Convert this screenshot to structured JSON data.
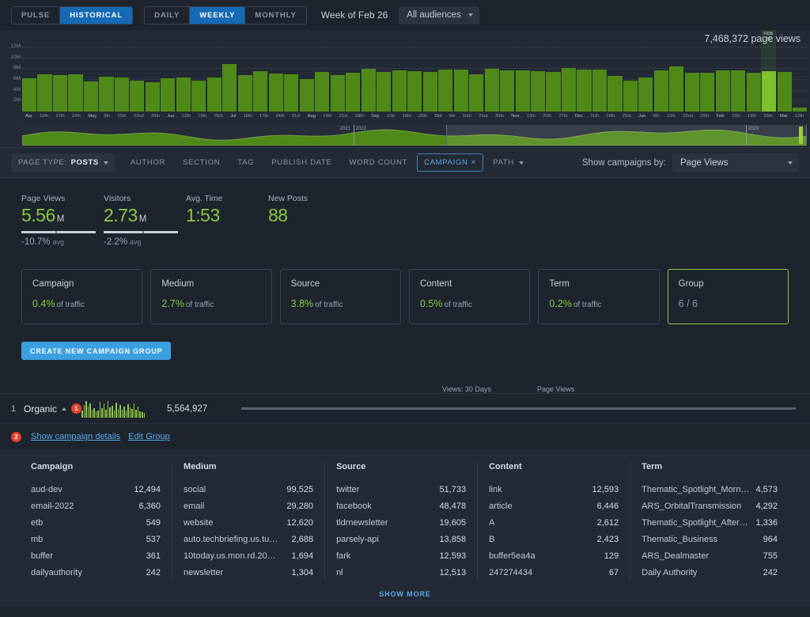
{
  "topbar": {
    "mode_tabs": [
      {
        "label": "PULSE",
        "active": false
      },
      {
        "label": "HISTORICAL",
        "active": true
      }
    ],
    "period_tabs": [
      {
        "label": "DAILY",
        "active": false
      },
      {
        "label": "WEEKLY",
        "active": true
      },
      {
        "label": "MONTHLY",
        "active": false
      }
    ],
    "week_label": "Week of Feb 26",
    "audience": "All audiences"
  },
  "chart_data": {
    "type": "bar",
    "title": "",
    "annotation": "7,468,372 page views",
    "highlight_label_line1": "FEB",
    "highlight_label_line2": "26",
    "highlight_index": 48,
    "ylabel": "",
    "xlabel": "",
    "ylim": [
      0,
      12000000
    ],
    "ytick_labels": [
      "12M",
      "10M",
      "8M",
      "6M",
      "4M",
      "2M"
    ],
    "ytick_values": [
      12000000,
      10000000,
      8000000,
      6000000,
      4000000,
      2000000
    ],
    "categories": [
      "Apr",
      "10th",
      "17th",
      "24th",
      "May",
      "8th",
      "15th",
      "22nd",
      "29th",
      "Jun",
      "12th",
      "19th",
      "26th",
      "Jul",
      "10th",
      "17th",
      "24th",
      "31st",
      "Aug",
      "14th",
      "21st",
      "28th",
      "Sep",
      "11th",
      "18th",
      "25th",
      "Oct",
      "9th",
      "16th",
      "23rd",
      "30th",
      "Nov",
      "13th",
      "20th",
      "27th",
      "Dec",
      "11th",
      "18th",
      "25th",
      "Jan",
      "8th",
      "15th",
      "22nd",
      "29th",
      "Feb",
      "12th",
      "19th",
      "26th",
      "Mar",
      "12th"
    ],
    "month_ticks": [
      "Apr",
      "May",
      "Jun",
      "Jul",
      "Aug",
      "Sep",
      "Oct",
      "Nov",
      "Dec",
      "Jan",
      "Feb",
      "Mar"
    ],
    "values": [
      6100000,
      6950000,
      6700000,
      6900000,
      5500000,
      6450000,
      6350000,
      5750000,
      5400000,
      6200000,
      6350000,
      5750000,
      6250000,
      8750000,
      6800000,
      7450000,
      7000000,
      6950000,
      5950000,
      7350000,
      6750000,
      7150000,
      7900000,
      7350000,
      7550000,
      7500000,
      7300000,
      7700000,
      7700000,
      6900000,
      7900000,
      7600000,
      7600000,
      7500000,
      7300000,
      8000000,
      7700000,
      7750000,
      6600000,
      5650000,
      6250000,
      7600000,
      8400000,
      7150000,
      7150000,
      7600000,
      7650000,
      7150000,
      7468372,
      7250000,
      700000
    ],
    "grid": true,
    "navigator": {
      "year_markers": [
        "2021",
        "2022",
        "2023"
      ],
      "selection_start_pct": 54,
      "selection_end_pct": 100
    }
  },
  "filterbar": {
    "page_type_prefix": "PAGE TYPE:",
    "page_type_value": "POSTS",
    "chips": [
      {
        "label": "AUTHOR",
        "selected": false
      },
      {
        "label": "SECTION",
        "selected": false
      },
      {
        "label": "TAG",
        "selected": false
      },
      {
        "label": "PUBLISH DATE",
        "selected": false
      },
      {
        "label": "WORD COUNT",
        "selected": false
      },
      {
        "label": "CAMPAIGN",
        "selected": true
      },
      {
        "label": "PATH",
        "selected": false
      }
    ],
    "show_by_label": "Show campaigns by:",
    "show_by_value": "Page Views"
  },
  "kpis": [
    {
      "label": "Page Views",
      "value": "5.56",
      "unit": "M",
      "delta": "-10.7%",
      "delta_sub": "avg",
      "has_bar": true,
      "marker_pct": 46
    },
    {
      "label": "Visitors",
      "value": "2.73",
      "unit": "M",
      "delta": "-2.2%",
      "delta_sub": "avg",
      "has_bar": true,
      "marker_pct": 52
    },
    {
      "label": "Avg. Time",
      "value": "1:53",
      "unit": "",
      "delta": "",
      "delta_sub": "",
      "has_bar": false,
      "marker_pct": 0
    },
    {
      "label": "New Posts",
      "value": "88",
      "unit": "",
      "delta": "",
      "delta_sub": "",
      "has_bar": false,
      "marker_pct": 0
    }
  ],
  "dimension_cards": [
    {
      "name": "Campaign",
      "value": "0.4%",
      "sub": "of traffic",
      "active": false,
      "muted": false
    },
    {
      "name": "Medium",
      "value": "2.7%",
      "sub": "of traffic",
      "active": false,
      "muted": false
    },
    {
      "name": "Source",
      "value": "3.8%",
      "sub": "of traffic",
      "active": false,
      "muted": false
    },
    {
      "name": "Content",
      "value": "0.5%",
      "sub": "of traffic",
      "active": false,
      "muted": false
    },
    {
      "name": "Term",
      "value": "0.2%",
      "sub": "of traffic",
      "active": false,
      "muted": false
    },
    {
      "name": "Group",
      "value": "6 / 6",
      "sub": "",
      "active": true,
      "muted": true
    }
  ],
  "create_button": "CREATE NEW CAMPAIGN GROUP",
  "group_list": {
    "col_sparkline": "Views: 30 Days",
    "col_pageviews": "Page Views",
    "row": {
      "rank": "1",
      "name": "Organic",
      "badge": "1",
      "pageviews": "5,564,927",
      "sparkline": [
        38,
        72,
        95,
        62,
        80,
        44,
        55,
        35,
        40,
        88,
        52,
        78,
        46,
        92,
        58,
        66,
        40,
        84,
        50,
        70,
        44,
        60,
        38,
        74,
        56,
        48,
        80,
        42,
        64,
        36,
        30,
        24
      ]
    },
    "detail": {
      "badge": "2",
      "show_details_link": "Show campaign details",
      "edit_group_link": "Edit Group"
    }
  },
  "table": {
    "columns": [
      {
        "header": "Campaign",
        "rows": [
          {
            "key": "aud-dev",
            "value": "12,494"
          },
          {
            "key": "email-2022",
            "value": "6,360"
          },
          {
            "key": "etb",
            "value": "549"
          },
          {
            "key": "mb",
            "value": "537"
          },
          {
            "key": "buffer",
            "value": "361"
          },
          {
            "key": "dailyauthority",
            "value": "242"
          }
        ]
      },
      {
        "header": "Medium",
        "rows": [
          {
            "key": "social",
            "value": "99,525"
          },
          {
            "key": "email",
            "value": "29,280"
          },
          {
            "key": "website",
            "value": "12,620"
          },
          {
            "key": "auto.techbriefing.us.tu…",
            "value": "2,688"
          },
          {
            "key": "10today.us.mon.rd.20…",
            "value": "1,694"
          },
          {
            "key": "newsletter",
            "value": "1,304"
          }
        ]
      },
      {
        "header": "Source",
        "rows": [
          {
            "key": "twitter",
            "value": "51,733"
          },
          {
            "key": "facebook",
            "value": "48,478"
          },
          {
            "key": "tldrnewsletter",
            "value": "19,605"
          },
          {
            "key": "parsely-api",
            "value": "13,858"
          },
          {
            "key": "fark",
            "value": "12,593"
          },
          {
            "key": "nl",
            "value": "12,513"
          }
        ]
      },
      {
        "header": "Content",
        "rows": [
          {
            "key": "link",
            "value": "12,593"
          },
          {
            "key": "article",
            "value": "6,446"
          },
          {
            "key": "A",
            "value": "2,612"
          },
          {
            "key": "B",
            "value": "2,423"
          },
          {
            "key": "buffer5ea4a",
            "value": "129"
          },
          {
            "key": "247274434",
            "value": "67"
          }
        ]
      },
      {
        "header": "Term",
        "rows": [
          {
            "key": "Thematic_Spotlight_Morn…",
            "value": "4,573"
          },
          {
            "key": "ARS_OrbitalTransmission",
            "value": "4,292"
          },
          {
            "key": "Thematic_Spotlight_After…",
            "value": "1,336"
          },
          {
            "key": "Thematic_Business",
            "value": "964"
          },
          {
            "key": "ARS_Dealmaster",
            "value": "755"
          },
          {
            "key": "Daily Authority",
            "value": "242"
          }
        ]
      }
    ],
    "show_more": "SHOW MORE"
  },
  "colors": {
    "accent_green": "#8cc63f",
    "bar_green": "#4f8a18",
    "bar_green_highlight": "#7cc22c",
    "link_blue": "#5aa9e6",
    "button_blue": "#3ba0e0",
    "active_tab_blue": "#1669b5",
    "badge_red": "#e8402a",
    "bg": "#1e242e",
    "panel_bg": "#232a35"
  }
}
